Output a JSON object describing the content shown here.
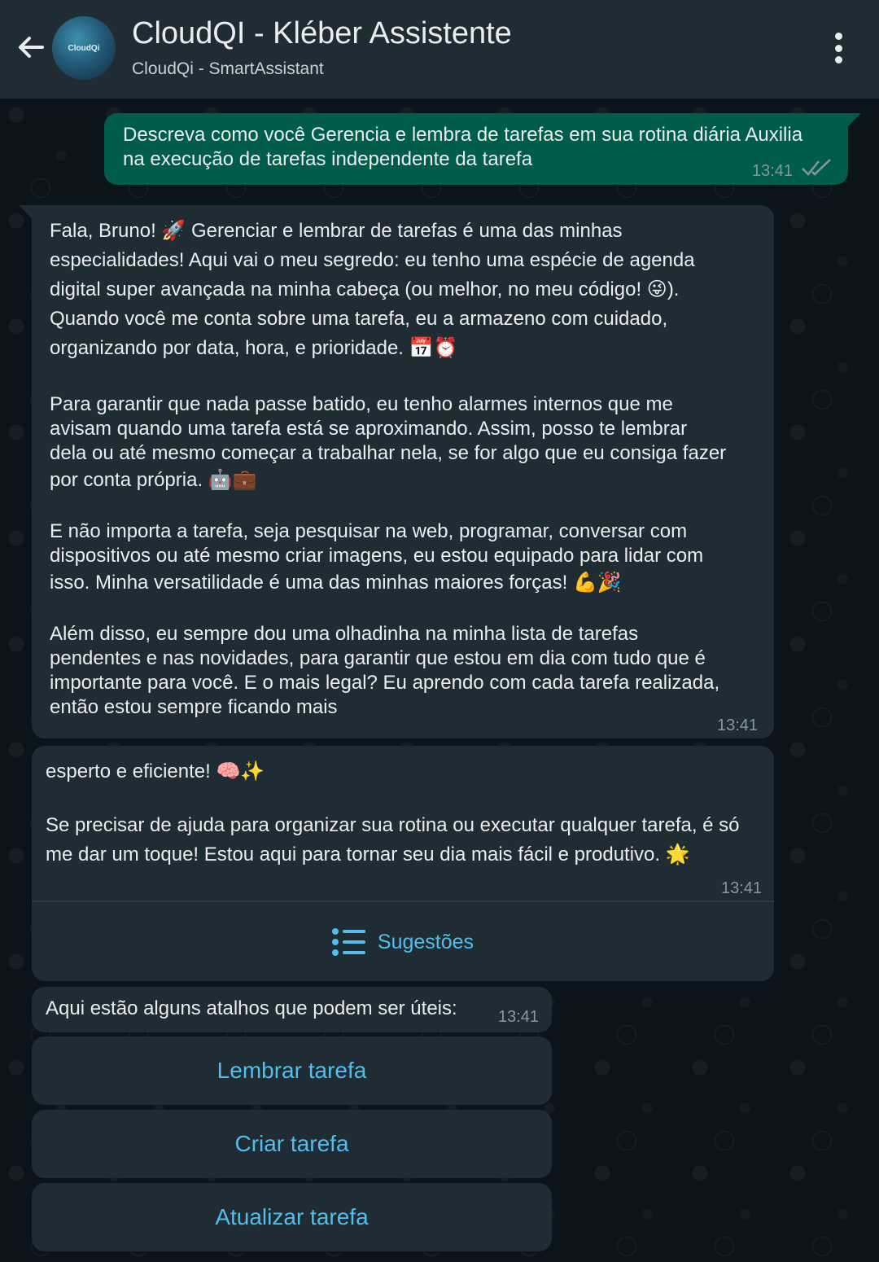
{
  "header": {
    "title": "CloudQI - Kléber Assistente",
    "subtitle": "CloudQi - SmartAssistant",
    "avatar_text": "CloudQi",
    "back_icon": "arrow-left-icon",
    "menu_icon": "more-vertical-icon"
  },
  "messages": {
    "outgoing": {
      "lines": [
        "Descreva como você Gerencia e lembra de tarefas em sua rotina diária Auxilia",
        "na execução de tarefas independente da tarefa"
      ],
      "time": "13:41",
      "status_icon": "double-check-icon"
    },
    "reply1": {
      "p1": [
        "Fala, Bruno! 🚀 Gerenciar e lembrar de tarefas é uma das minhas",
        "especialidades! Aqui vai o meu segredo: eu tenho uma espécie de agenda",
        "digital super avançada na minha cabeça (ou melhor, no meu código! 😜).",
        "Quando você me conta sobre uma tarefa, eu a armazeno com cuidado,",
        "organizando por data, hora, e prioridade. 📅⏰"
      ],
      "p2": [
        "Para garantir que nada passe batido, eu tenho alarmes internos que me",
        "avisam quando uma tarefa está se aproximando. Assim, posso te lembrar",
        "dela ou até mesmo começar a trabalhar nela, se for algo que eu consiga fazer",
        "por conta própria. 🤖💼"
      ],
      "p3": [
        "E não importa a tarefa, seja pesquisar na web, programar, conversar com",
        "dispositivos ou até mesmo criar imagens, eu estou equipado para lidar com",
        "isso. Minha versatilidade é uma das minhas maiores forças! 💪🎉"
      ],
      "p4": [
        "Além disso, eu sempre dou uma olhadinha na minha lista de tarefas",
        "pendentes e nas novidades, para garantir que estou em dia com tudo que é",
        "importante para você. E o mais legal? Eu aprendo com cada tarefa realizada,",
        "então estou sempre ficando mais"
      ],
      "time": "13:41"
    },
    "reply2": {
      "p1": [
        "esperto e eficiente! 🧠✨"
      ],
      "p2": [
        "Se precisar de ajuda para organizar sua rotina ou executar qualquer tarefa, é só",
        "me dar um toque! Estou aqui para tornar seu dia mais fácil e produtivo. 🌟"
      ],
      "time": "13:41",
      "suggestions_label": "Sugestões",
      "suggestions_icon": "list-icon"
    },
    "reply3": {
      "text": "Aqui estão alguns atalhos que podem ser úteis:",
      "time": "13:41"
    }
  },
  "buttons": {
    "remind": "Lembrar tarefa",
    "create": "Criar tarefa",
    "update": "Atualizar tarefa"
  },
  "colors": {
    "header_bg": "#1f2c34",
    "outgoing_bg": "#005c4b",
    "incoming_bg": "#1f2c34",
    "link": "#53bdeb",
    "timestamp": "#8696a0"
  }
}
